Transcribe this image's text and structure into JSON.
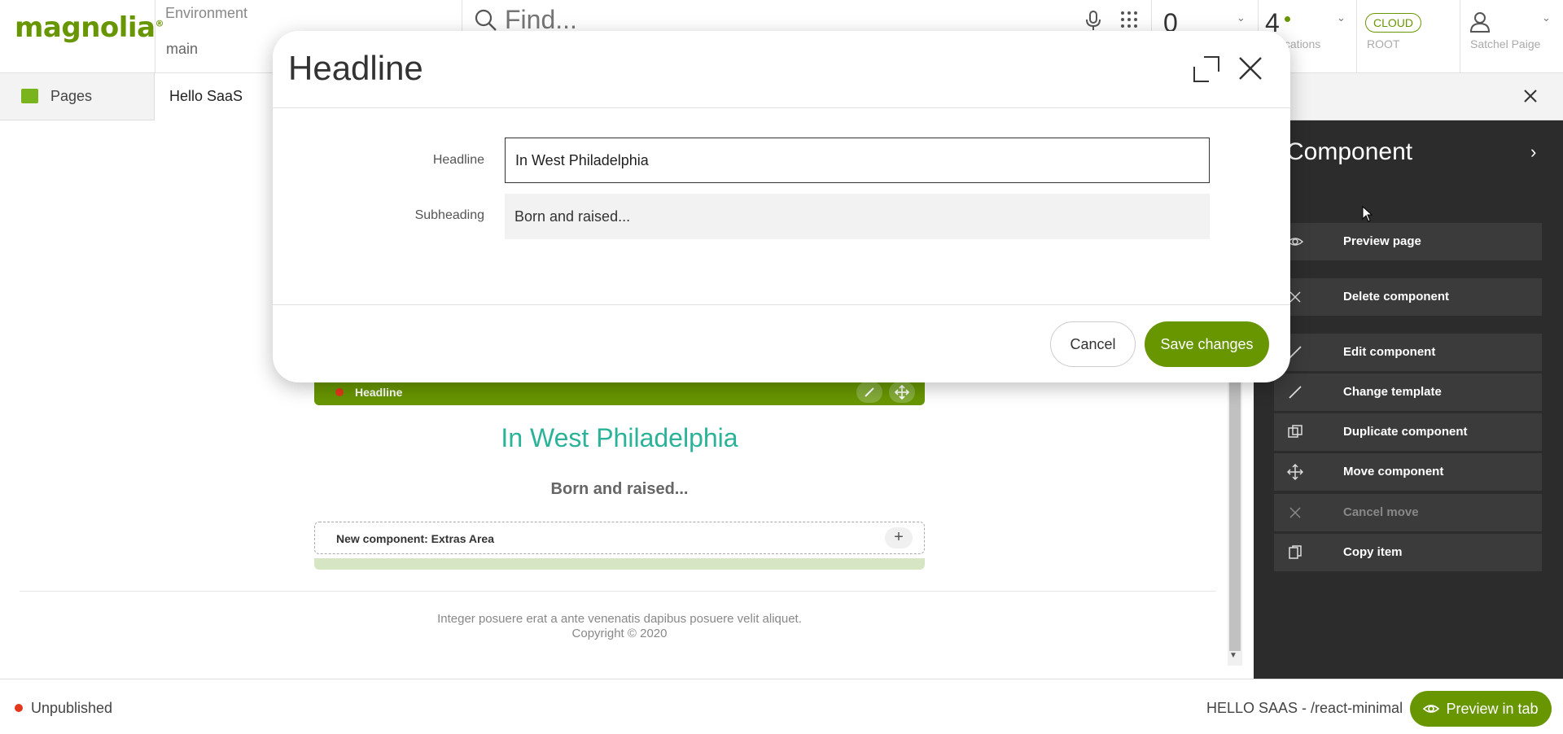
{
  "app": {
    "logo": "magnolia",
    "environment_label": "Environment",
    "environment_value": "main",
    "search_placeholder": "Find...",
    "tasks_count": "0",
    "notifications_count": "4",
    "notifications_label": "Notifications",
    "cloud_badge": "CLOUD",
    "cloud_label": "ROOT",
    "user_name": "Satchel Paige"
  },
  "tabs": {
    "app_label": "Pages",
    "page_label": "Hello SaaS"
  },
  "preview": {
    "component_label": "Headline",
    "headline": "In West Philadelphia",
    "subheading": "Born and raised...",
    "extras_label": "New component: Extras Area",
    "extras_add": "+",
    "footer_line1": "Integer posuere erat a ante venenatis dapibus posuere velit aliquet.",
    "footer_line2": "Copyright © 2020"
  },
  "actionbar": {
    "title": "Component",
    "items": [
      {
        "label": "Preview page",
        "icon": "eye-icon",
        "enabled": true
      },
      {
        "label": "Delete component",
        "icon": "close-icon",
        "enabled": true
      },
      {
        "label": "Edit component",
        "icon": "pencil-icon",
        "enabled": true
      },
      {
        "label": "Change template",
        "icon": "pencil-icon",
        "enabled": true
      },
      {
        "label": "Duplicate component",
        "icon": "duplicate-icon",
        "enabled": true
      },
      {
        "label": "Move component",
        "icon": "move-icon",
        "enabled": true
      },
      {
        "label": "Cancel move",
        "icon": "close-icon",
        "enabled": false
      },
      {
        "label": "Copy item",
        "icon": "copy-icon",
        "enabled": true
      }
    ]
  },
  "status": {
    "state": "Unpublished",
    "path": "HELLO SAAS - /react-minimal",
    "preview_button": "Preview in tab"
  },
  "dialog": {
    "title": "Headline",
    "fields": [
      {
        "label": "Headline",
        "value": "In West Philadelphia"
      },
      {
        "label": "Subheading",
        "value": "Born and raised..."
      }
    ],
    "cancel_label": "Cancel",
    "save_label": "Save changes"
  },
  "colors": {
    "brand": "#689600",
    "headline_teal": "#2bb39a",
    "status_red": "#e2381b",
    "actionbar_bg": "#2c2c2c"
  }
}
